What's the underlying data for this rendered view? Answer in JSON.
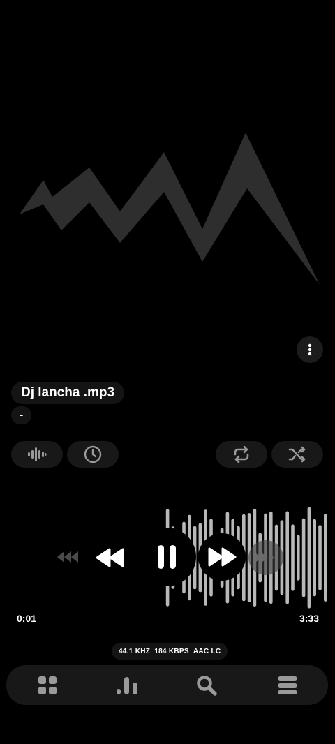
{
  "track": {
    "title": "Dj lancha .mp3",
    "artist": "-"
  },
  "playback": {
    "current_time": "0:01",
    "total_time": "3:33",
    "state": "playing"
  },
  "audio_info": {
    "sample_rate": "44.1 KHZ",
    "bitrate": "184 KBPS",
    "codec": "AAC LC"
  },
  "controls": {
    "left": [
      "waveform-icon",
      "clock-icon"
    ],
    "right": [
      "repeat-icon",
      "shuffle-icon"
    ]
  },
  "nav": {
    "items": [
      "grid-icon",
      "bar-chart-icon",
      "search-icon",
      "menu-icon"
    ]
  },
  "colors": {
    "background": "#000000",
    "surface": "#181818",
    "art": "#2e2e2e",
    "wave": "#b8b8b8",
    "icon": "#9a9a9a"
  }
}
